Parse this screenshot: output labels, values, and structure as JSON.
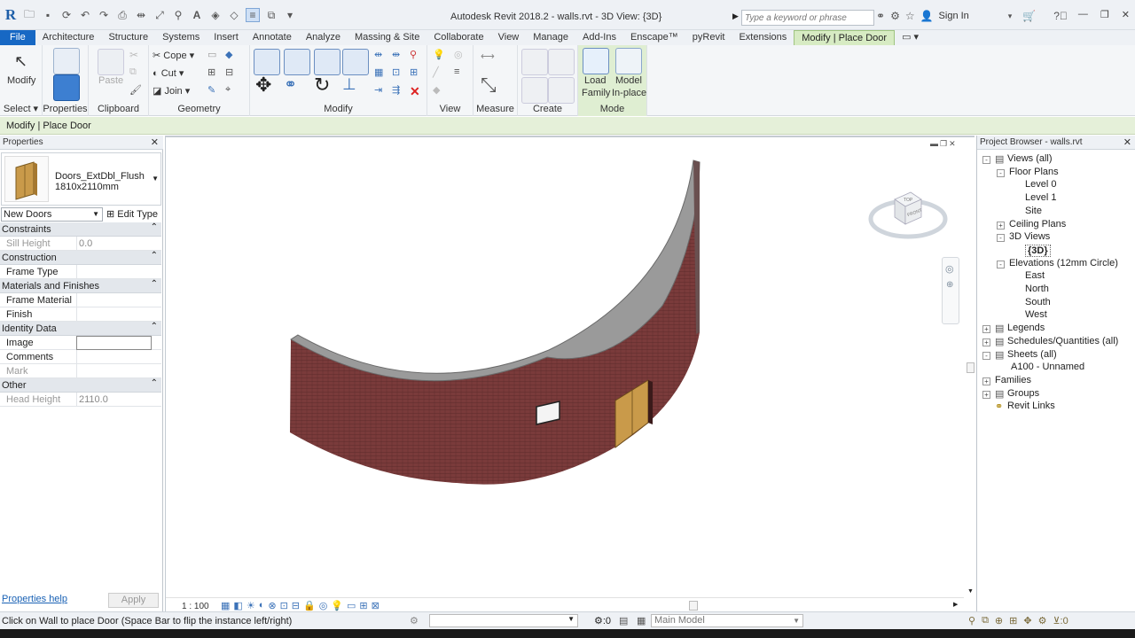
{
  "window": {
    "title": "Autodesk Revit 2018.2 -    walls.rvt - 3D View: {3D}",
    "search_placeholder": "Type a keyword or phrase",
    "sign_in": "Sign In"
  },
  "tabs": [
    "File",
    "Architecture",
    "Structure",
    "Systems",
    "Insert",
    "Annotate",
    "Analyze",
    "Massing & Site",
    "Collaborate",
    "View",
    "Manage",
    "Add-Ins",
    "Enscape™",
    "pyRevit",
    "Extensions",
    "Modify | Place Door"
  ],
  "ribbon": {
    "select": {
      "modify_label": "Modify",
      "panel_label": "Select"
    },
    "properties": {
      "panel_label": "Properties"
    },
    "clipboard": {
      "paste_label": "Paste",
      "panel_label": "Clipboard"
    },
    "geometry": {
      "cope_label": "Cope",
      "cut_label": "Cut",
      "join_label": "Join",
      "panel_label": "Geometry"
    },
    "modify": {
      "panel_label": "Modify"
    },
    "view": {
      "panel_label": "View"
    },
    "measure": {
      "panel_label": "Measure"
    },
    "create": {
      "panel_label": "Create"
    },
    "mode": {
      "load_family_1": "Load",
      "load_family_2": "Family",
      "model_inplace_1": "Model",
      "model_inplace_2": "In-place",
      "panel_label": "Mode"
    }
  },
  "context_bar": "Modify | Place Door",
  "properties": {
    "title": "Properties",
    "type_family": "Doors_ExtDbl_Flush",
    "type_size": "1810x2110mm",
    "instance_filter": "New Doors",
    "edit_type": "Edit Type",
    "rows": [
      {
        "kind": "cat",
        "label": "Constraints"
      },
      {
        "kind": "param",
        "label": "Sill Height",
        "value": "0.0",
        "dim": true
      },
      {
        "kind": "cat",
        "label": "Construction"
      },
      {
        "kind": "param",
        "label": "Frame Type",
        "value": ""
      },
      {
        "kind": "cat",
        "label": "Materials and Finishes"
      },
      {
        "kind": "param",
        "label": "Frame Material",
        "value": ""
      },
      {
        "kind": "param",
        "label": "Finish",
        "value": ""
      },
      {
        "kind": "cat",
        "label": "Identity Data"
      },
      {
        "kind": "param",
        "label": "Image",
        "value": "",
        "boxed": true
      },
      {
        "kind": "param",
        "label": "Comments",
        "value": ""
      },
      {
        "kind": "param",
        "label": "Mark",
        "value": "",
        "dim": true
      },
      {
        "kind": "cat",
        "label": "Other"
      },
      {
        "kind": "param",
        "label": "Head Height",
        "value": "2110.0",
        "dim": true
      }
    ],
    "help_link": "Properties help",
    "apply": "Apply"
  },
  "viewport": {
    "scale": "1 : 100",
    "viewcube_top": "TOP",
    "viewcube_front": "FRONT"
  },
  "browser": {
    "title": "Project Browser - walls.rvt",
    "nodes": [
      {
        "label": "Views (all)",
        "depth": 0,
        "expander": "-",
        "icon": true
      },
      {
        "label": "Floor Plans",
        "depth": 1,
        "expander": "-"
      },
      {
        "label": "Level 0",
        "depth": 2
      },
      {
        "label": "Level 1",
        "depth": 2
      },
      {
        "label": "Site",
        "depth": 2
      },
      {
        "label": "Ceiling Plans",
        "depth": 1,
        "expander": "+"
      },
      {
        "label": "3D Views",
        "depth": 1,
        "expander": "-"
      },
      {
        "label": "{3D}",
        "depth": 2,
        "bold": true
      },
      {
        "label": "Elevations (12mm Circle)",
        "depth": 1,
        "expander": "-"
      },
      {
        "label": "East",
        "depth": 2
      },
      {
        "label": "North",
        "depth": 2
      },
      {
        "label": "South",
        "depth": 2
      },
      {
        "label": "West",
        "depth": 2
      },
      {
        "label": "Legends",
        "depth": 0,
        "expander": "+",
        "icon": true
      },
      {
        "label": "Schedules/Quantities (all)",
        "depth": 0,
        "expander": "+",
        "icon": true
      },
      {
        "label": "Sheets (all)",
        "depth": 0,
        "expander": "-",
        "icon": true
      },
      {
        "label": "A100 - Unnamed",
        "depth": 1
      },
      {
        "label": "Families",
        "depth": 0,
        "expander": "+"
      },
      {
        "label": "Groups",
        "depth": 0,
        "expander": "+",
        "icon": true
      },
      {
        "label": "Revit Links",
        "depth": 0,
        "icon": true
      }
    ]
  },
  "status": {
    "text": "Click on Wall to place Door (Space Bar to flip the instance left/right)",
    "zero": ":0",
    "model": "Main Model",
    "filter_count": ":0"
  }
}
